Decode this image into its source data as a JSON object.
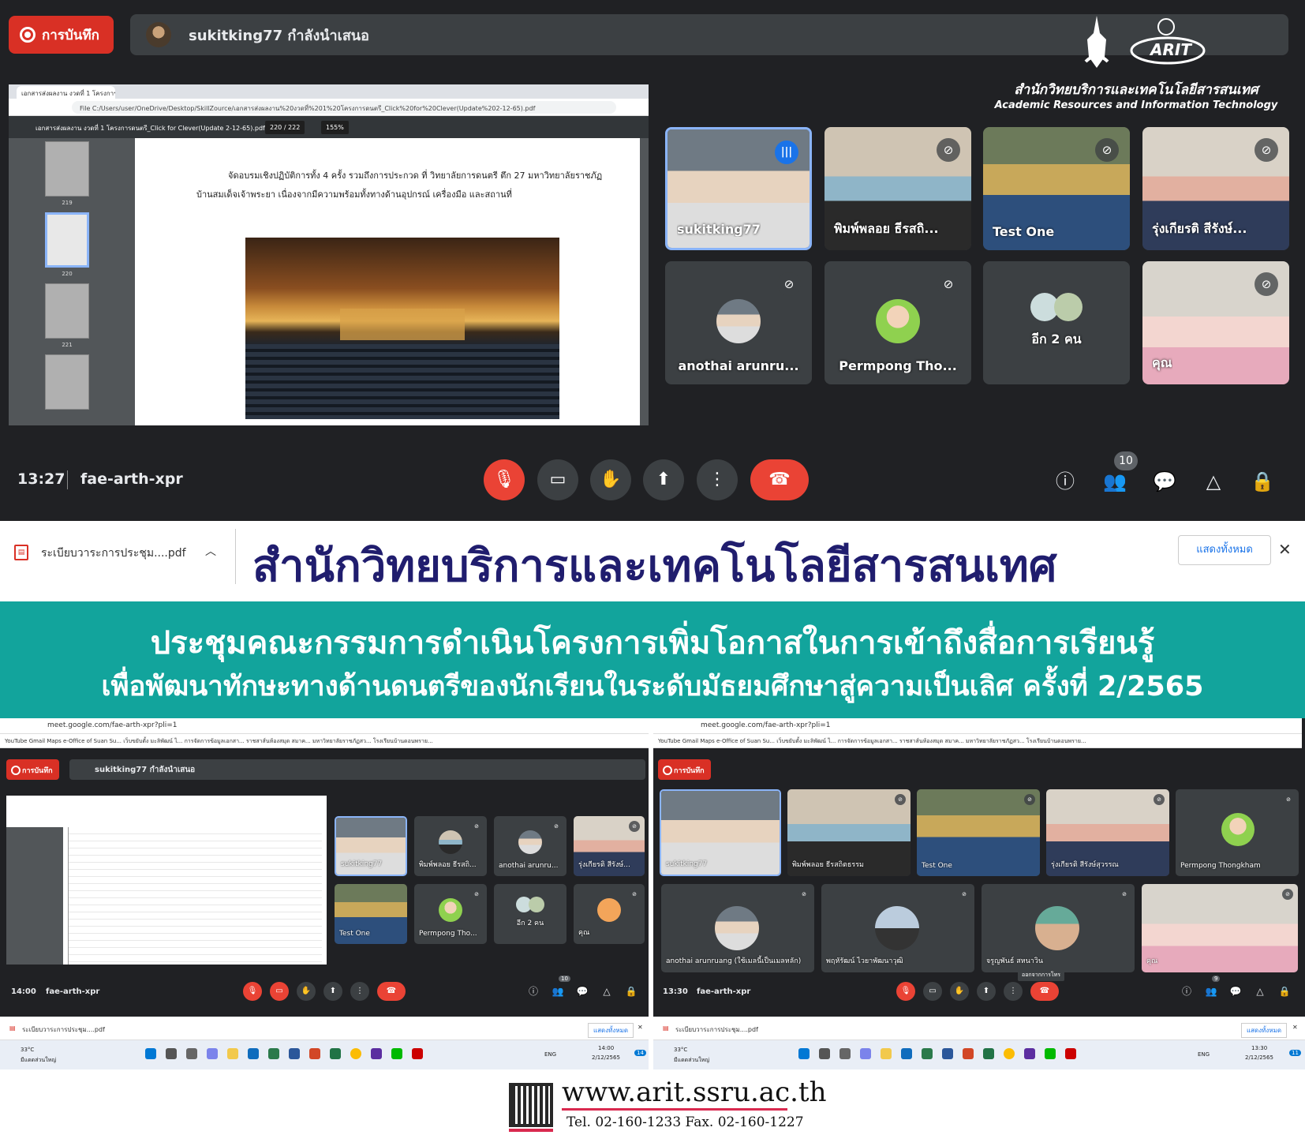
{
  "top": {
    "record_label": "การบันทึก",
    "presenting_text": "sukitking77 กำลังนำเสนอ",
    "logo_th": "สำนักวิทยบริการและเทคโนโลยีสารสนเทศ",
    "logo_en": "Academic Resources and Information Technology",
    "logo_mark": "ARIT",
    "share": {
      "url": "File C:/Users/user/OneDrive/Desktop/SkillZource/เอกสารส่งผลงาน%20งวดที่%201%20โครงการดนตรี_Click%20for%20Clever(Update%202-12-65).pdf",
      "pdf_title": "เอกสารส่งผลงาน งวดที่ 1 โครงการดนตรี_Click for Clever(Update 2-12-65).pdf",
      "page_indicator": "220 / 222",
      "zoom": "155%",
      "thumb_labels": [
        "219",
        "220",
        "221"
      ],
      "body_line1": "จัดอบรมเชิงปฏิบัติการทั้ง 4 ครั้ง รวมถึงการประกวด ที่ วิทยาลัยการดนตรี ตึก 27 มหาวิทยาลัยราชภัฏ",
      "body_line2": "บ้านสมเด็จเจ้าพระยา เนื่องจากมีความพร้อมทั้งทางด้านอุปกรณ์ เครื่องมือ และสถานที่"
    },
    "tiles": [
      {
        "name": "sukitking77"
      },
      {
        "name": "พิมพ์พลอย ธีรสถิ..."
      },
      {
        "name": "Test One"
      },
      {
        "name": "รุ่งเกียรติ สีรังษ์..."
      },
      {
        "name": "anothai arunru..."
      },
      {
        "name": "Permpong Tho..."
      },
      {
        "name": "อีก 2 คน"
      },
      {
        "name": "คุณ"
      }
    ],
    "clock": "13:27",
    "meeting_code": "fae-arth-xpr",
    "participant_count": "10"
  },
  "banner": {
    "download_name": "ระเบียบวาระการประชุม....pdf",
    "show_all": "แสดงทั้งหมด",
    "org_title": "สำนักวิทยบริการและเทคโนโลยีสารสนเทศ",
    "line1": "ประชุมคณะกรรมการดำเนินโครงการเพิ่มโอกาสในการเข้าถึงสื่อการเรียนรู้",
    "line2": "เพื่อพัฒนาทักษะทางด้านดนตรีของนักเรียนในระดับมัธยมศึกษาสู่ความเป็นเลิศ ครั้งที่ 2/2565"
  },
  "left_shot": {
    "url": "meet.google.com/fae-arth-xpr?pli=1",
    "bookmarks": "YouTube   Gmail   Maps   e-Office of Suan Su...   เว็บขยับตั้ง มะลิพัฒน์ ไ...   การจัดการข้อมูลเอกสา...   ราชสาส์นห้องสมุด สมาค...   มหาวิทยาลัยราชภัฏสว...   โรงเรียนบ้านดอนพราย...",
    "record_label": "การบันทึก",
    "presenting_text": "sukitking77 กำลังนำเสนอ",
    "tiles": [
      "sukitking77",
      "พิมพ์พลอย ธีรสถิ...",
      "anothai arunru...",
      "รุ่งเกียรติ สีรังษ์...",
      "Test One",
      "Permpong Tho...",
      "อีก 2 คน",
      "คุณ"
    ],
    "clock": "14:00",
    "meeting_code": "fae-arth-xpr",
    "participant_count": "10",
    "download_name": "ระเบียบวาระการประชุม....pdf",
    "show_all": "แสดงทั้งหมด",
    "weather": "33°C",
    "weather_desc": "มีแดดส่วนใหญ่",
    "lang": "ENG",
    "time": "14:00",
    "date": "2/12/2565",
    "notif": "14"
  },
  "right_shot": {
    "url": "meet.google.com/fae-arth-xpr?pli=1",
    "bookmarks": "YouTube   Gmail   Maps   e-Office of Suan Su...   เว็บขยับตั้ง มะลิพัฒน์ ไ...   การจัดการข้อมูลเอกสา...   ราชสาส์นห้องสมุด สมาค...   มหาวิทยาลัยราชภัฏสว...   โรงเรียนบ้านดอนพราย...",
    "record_label": "การบันทึก",
    "tiles": [
      "sukitking77",
      "พิมพ์พลอย ธีรสถิตธรรม",
      "Test One",
      "รุ่งเกียรติ สีรังษ์สุวรรณ",
      "Permpong Thongkham",
      "anothai arunruang (ใช้เมลนี้เป็นเมลหลัก)",
      "พฤหัรัฒน์ ไวยาพัฒนาวุฒิ",
      "จรูญพันธ์ สหนาวิน",
      "คุณ"
    ],
    "leave_tip": "ออกจากการโทร",
    "clock": "13:30",
    "meeting_code": "fae-arth-xpr",
    "participant_count": "9",
    "download_name": "ระเบียบวาระการประชุม....pdf",
    "show_all": "แสดงทั้งหมด",
    "weather": "33°C",
    "weather_desc": "มีแดดส่วนใหญ่",
    "lang": "ENG",
    "time": "13:30",
    "date": "2/12/2565",
    "notif": "11"
  },
  "footer": {
    "website": "www.arit.ssru.ac.th",
    "tel": "Tel. 02-160-1233 Fax. 02-160-1227"
  },
  "colors": {
    "meet_bg": "#202124",
    "tile_bg": "#3c4043",
    "record_red": "#d93025",
    "end_red": "#ea4335",
    "speaker_blue": "#8ab4f8",
    "banner_teal": "#12a49c",
    "title_navy": "#201d6e",
    "accent_pink": "#d9294f"
  },
  "icons": [
    "record-icon",
    "mic-off-icon",
    "camera-icon",
    "raise-hand-icon",
    "present-icon",
    "more-icon",
    "end-call-icon",
    "info-icon",
    "people-icon",
    "chat-icon",
    "activities-icon",
    "host-controls-icon",
    "pdf-file-icon",
    "chevron-up-icon",
    "close-icon",
    "qr-code-icon"
  ]
}
